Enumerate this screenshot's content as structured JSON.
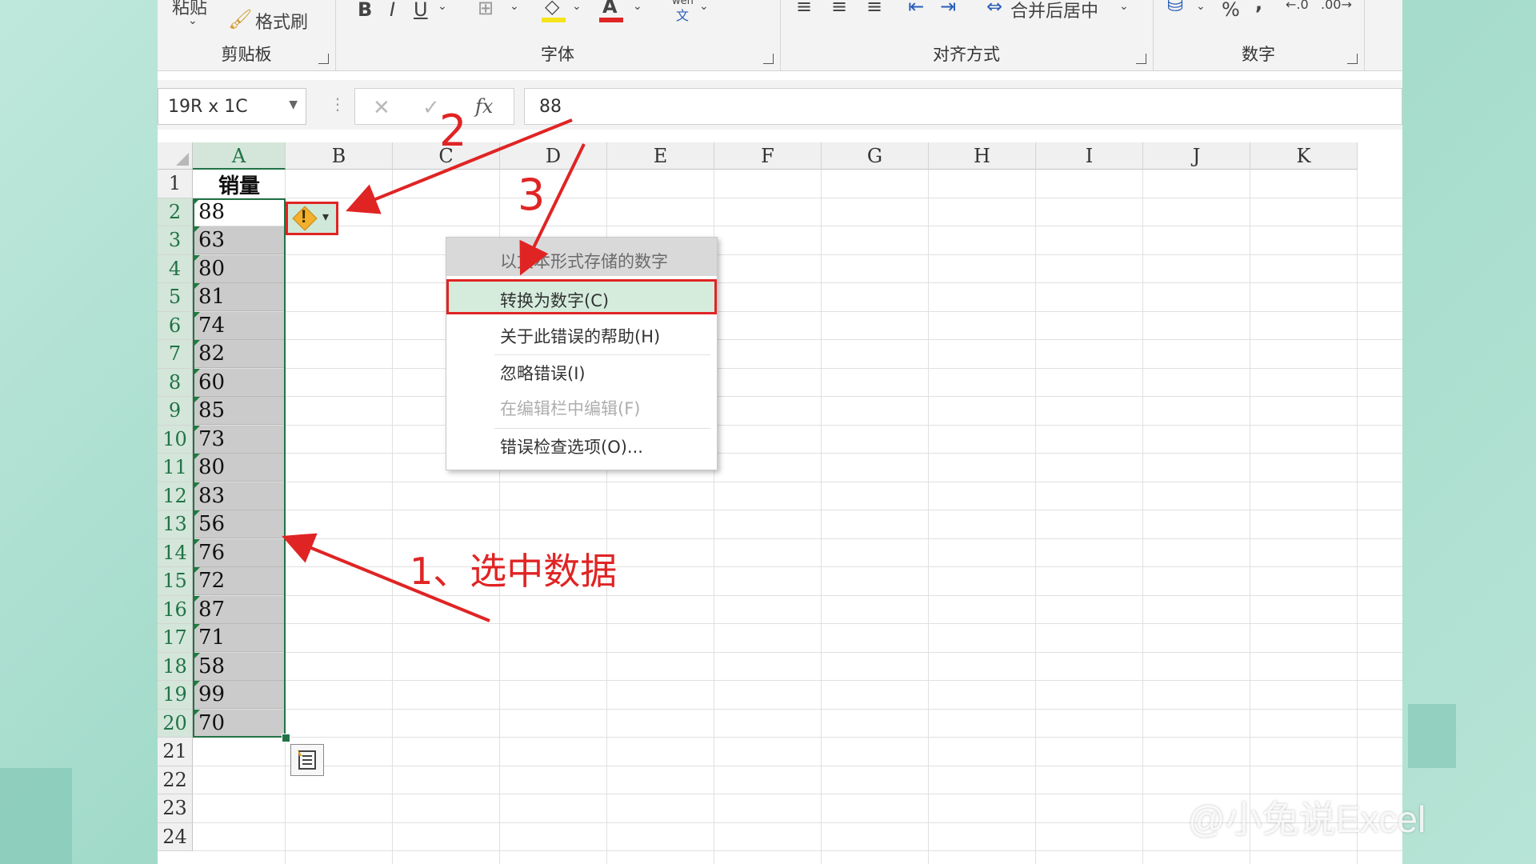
{
  "ribbon": {
    "paste_label": "粘贴",
    "format_painter_label": "格式刷",
    "groups": {
      "clipboard": "剪贴板",
      "font": "字体",
      "alignment": "对齐方式",
      "number": "数字"
    },
    "merge_center_label": "合并后居中",
    "percent_symbol": "%",
    "comma_symbol": ",",
    "wen_label": "wén",
    "wen_char": "文"
  },
  "formula_bar": {
    "name_box": "19R x 1C",
    "fx_label": "fx",
    "value": "88"
  },
  "grid": {
    "columns": [
      "A",
      "B",
      "C",
      "D",
      "E",
      "F",
      "G",
      "H",
      "I",
      "J",
      "K"
    ],
    "rows": [
      "1",
      "2",
      "3",
      "4",
      "5",
      "6",
      "7",
      "8",
      "9",
      "10",
      "11",
      "12",
      "13",
      "14",
      "15",
      "16",
      "17",
      "18",
      "19",
      "20",
      "21",
      "22",
      "23",
      "24"
    ],
    "header_cell": "销量",
    "values": [
      "88",
      "63",
      "80",
      "81",
      "74",
      "82",
      "60",
      "85",
      "73",
      "80",
      "83",
      "56",
      "76",
      "72",
      "87",
      "71",
      "58",
      "99",
      "70"
    ]
  },
  "error_menu": {
    "header": "以文本形式存储的数字",
    "items": [
      "转换为数字(C)",
      "关于此错误的帮助(H)",
      "忽略错误(I)",
      "在编辑栏中编辑(F)",
      "错误检查选项(O)..."
    ]
  },
  "annotations": {
    "step1": "1、选中数据",
    "step2": "2",
    "step3": "3"
  },
  "watermark": "@小兔说Excel",
  "colors": {
    "accent_green": "#217346",
    "annotation_red": "#e02424"
  }
}
